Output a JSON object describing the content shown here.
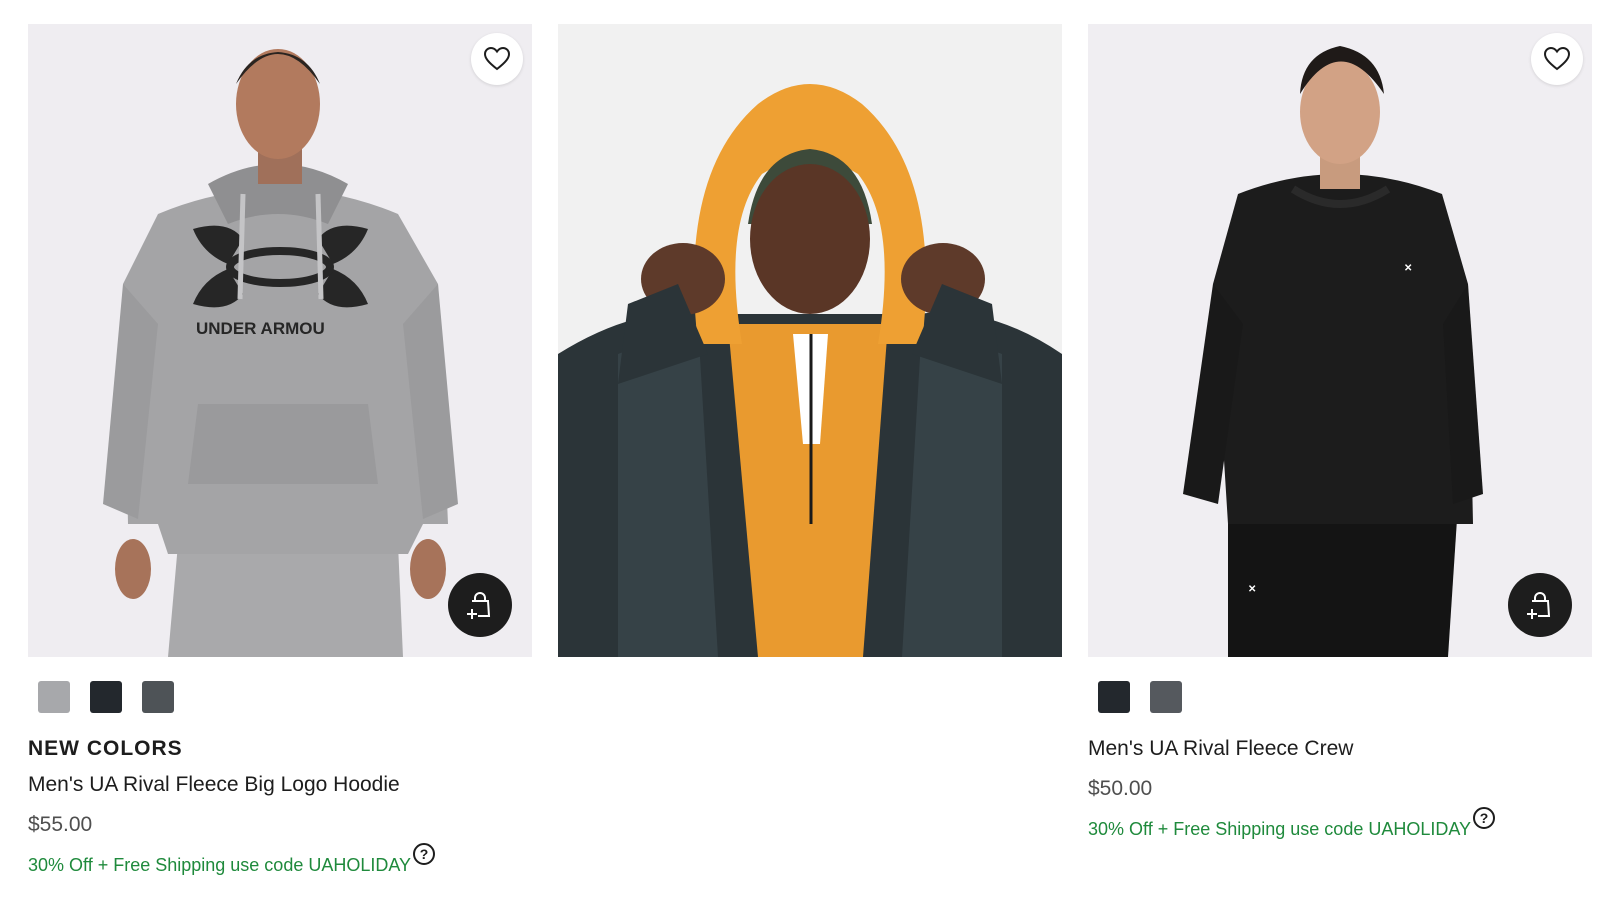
{
  "products": [
    {
      "badge": "NEW COLORS",
      "title": "Men's UA Rival Fleece Big Logo Hoodie",
      "price": "$55.00",
      "promo": "30% Off + Free Shipping use code UAHOLIDAY",
      "help_symbol": "?",
      "logo_text": "UNDER ARMOU",
      "swatches": [
        "#a7a8ab",
        "#23282d",
        "#4e5357"
      ],
      "icons": {
        "wishlist": "heart-icon",
        "quick_add": "bag-plus-icon"
      }
    },
    {
      "type": "promo-image"
    },
    {
      "badge": "",
      "title": "Men's UA Rival Fleece Crew",
      "price": "$50.00",
      "promo": "30% Off + Free Shipping use code UAHOLIDAY",
      "help_symbol": "?",
      "swatches": [
        "#23282d",
        "#55595e"
      ],
      "icons": {
        "wishlist": "heart-icon",
        "quick_add": "bag-plus-icon"
      }
    }
  ],
  "colors": {
    "promo_text": "#1f8a3c",
    "quick_add_bg": "#1d1d1d"
  }
}
